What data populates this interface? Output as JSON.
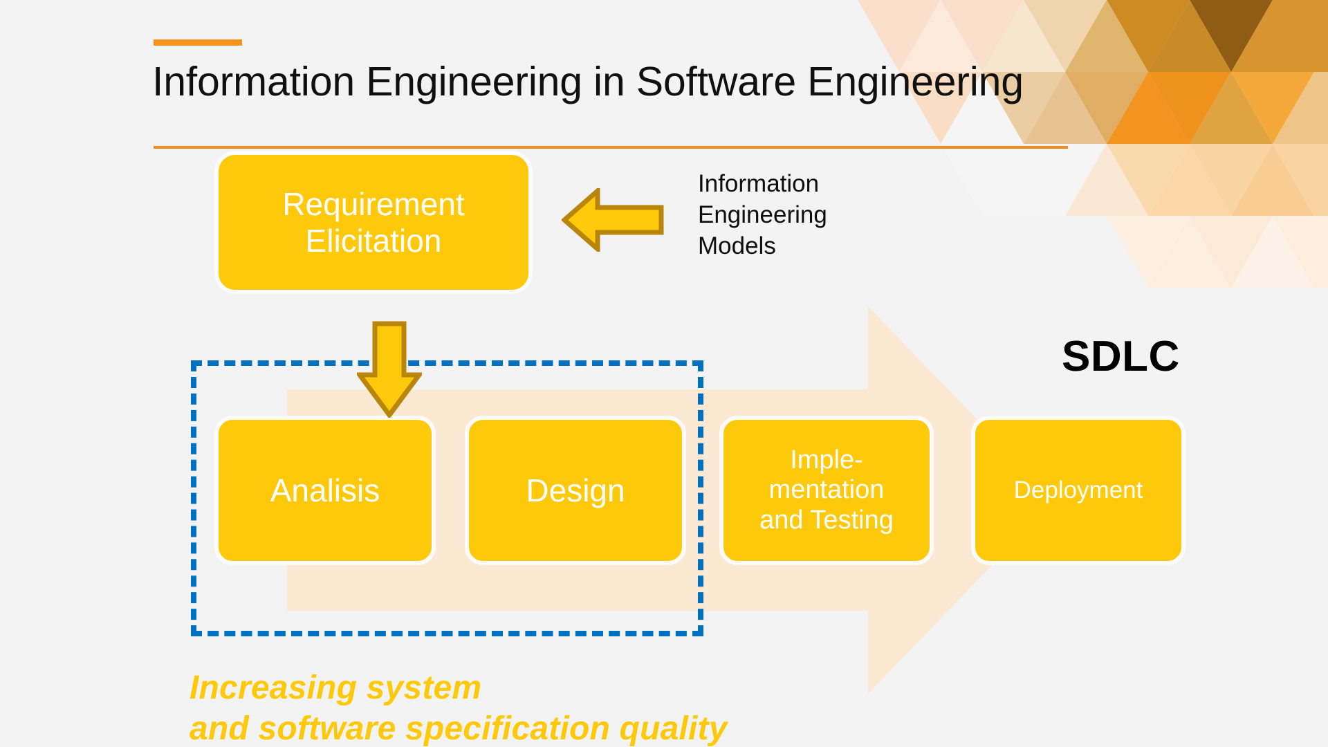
{
  "slide": {
    "background_color": "#f3f3f3",
    "accent_color": "#F6921E",
    "rule_color": "#F08A1E",
    "box_fill_color": "#FFC90B",
    "box_border_color": "#FBFBFB",
    "dashed_color": "#0070C0",
    "arrow_outline_color": "#B8860B",
    "arrow_fill_color": "#FFC90B",
    "band_color": "#FCEBD3"
  },
  "header": {
    "title": "Information Engineering in Software Engineering"
  },
  "diagram": {
    "requirement_box": {
      "label": "Requirement\nElicitation"
    },
    "ie_models_note": {
      "label": "Information\nEngineering\nModels"
    },
    "sdlc_label": "SDLC",
    "phase_boxes": [
      {
        "id": "analysis",
        "label": "Analisis"
      },
      {
        "id": "design",
        "label": "Design"
      },
      {
        "id": "implementation",
        "label": "Imple-\nmentation\nand Testing"
      },
      {
        "id": "deployment",
        "label": "Deployment"
      }
    ],
    "quality_note": "Increasing system\nand software specification quality",
    "arrows": [
      {
        "id": "left-arrow",
        "direction": "left"
      },
      {
        "id": "down-arrow",
        "direction": "down"
      },
      {
        "id": "sdlc-flow-arrow",
        "direction": "right"
      }
    ],
    "dashed_group": {
      "label": "dashed selection region"
    }
  }
}
